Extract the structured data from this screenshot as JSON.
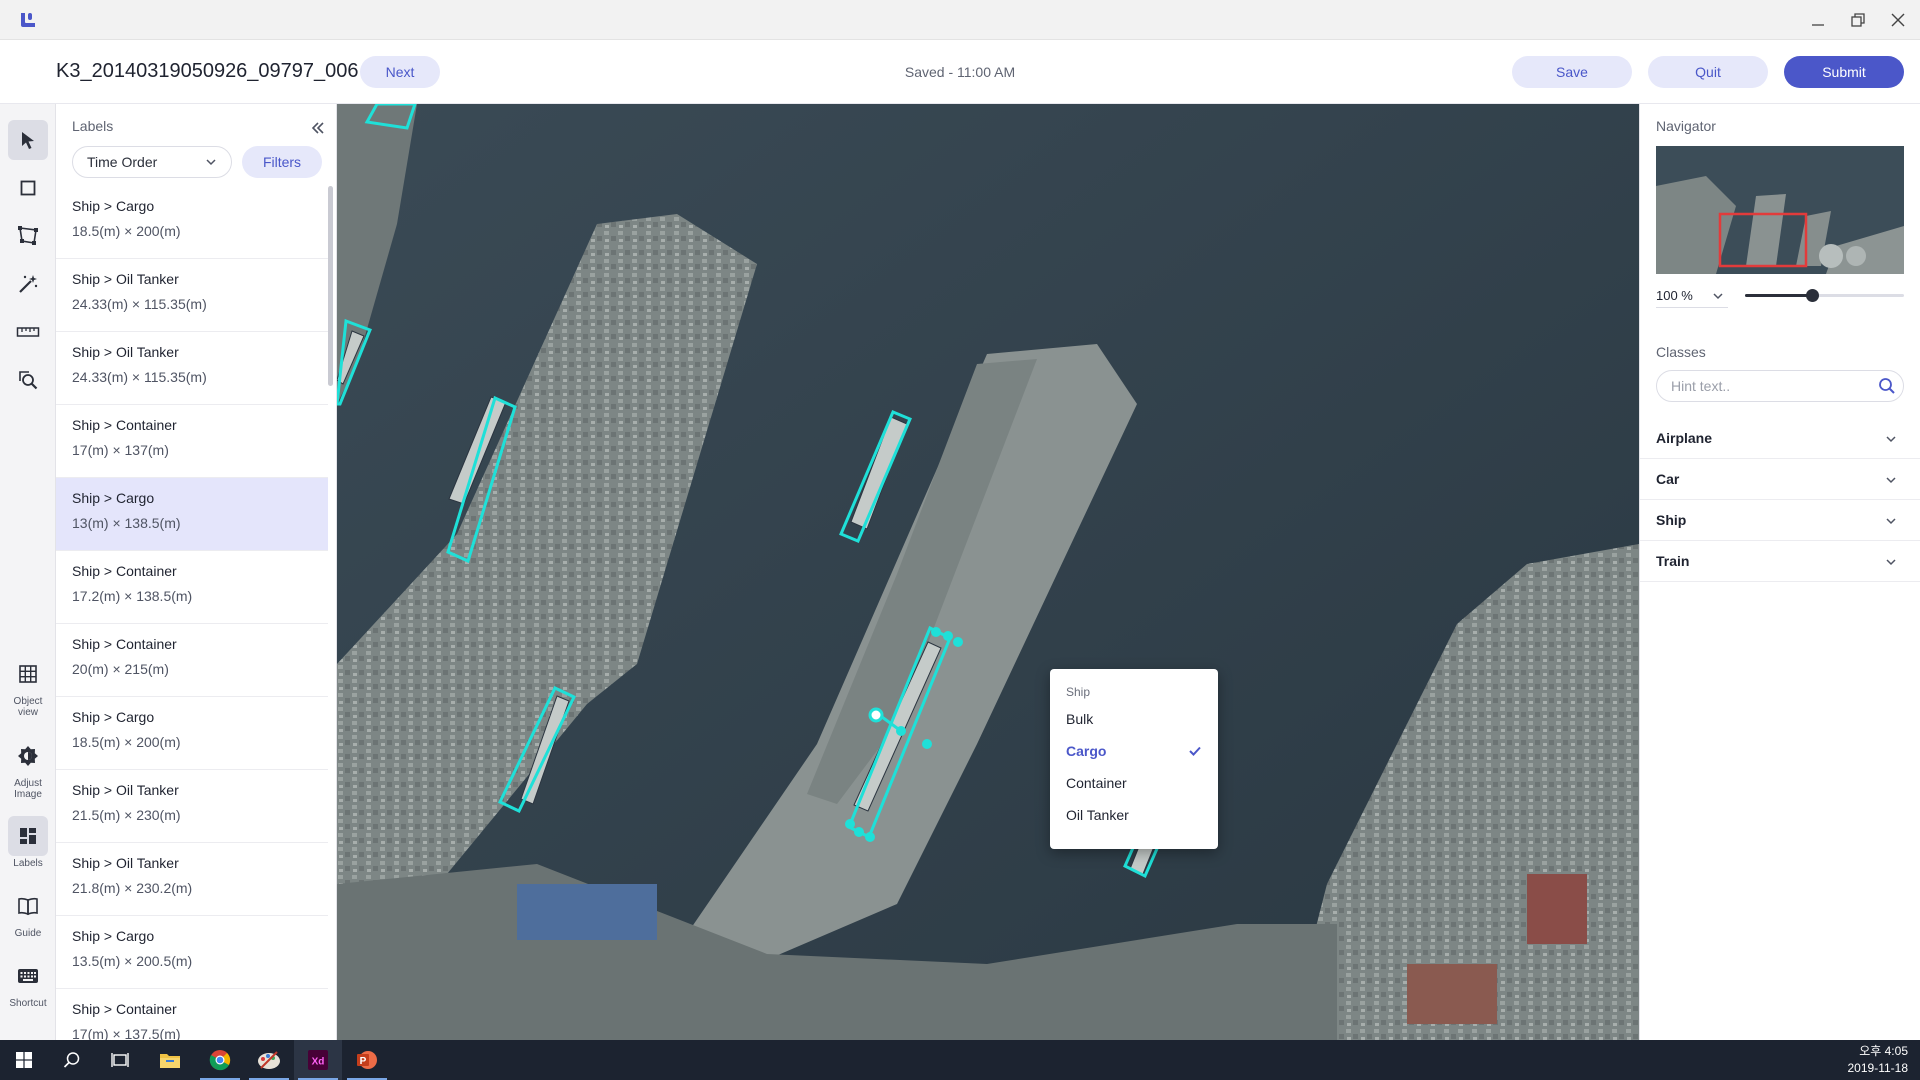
{
  "header": {
    "file_name": "K3_20140319050926_09797_006",
    "next_label": "Next",
    "saved_status": "Saved - 11:00 AM",
    "save_label": "Save",
    "quit_label": "Quit",
    "submit_label": "Submit"
  },
  "toolbar": {
    "tools": [
      "select-tool",
      "rectangle-tool",
      "polygon-tool",
      "magic-wand-tool",
      "measure-tool",
      "inspect-tool"
    ],
    "object_view_label": "Object view",
    "adjust_image_label": "Adjust Image",
    "labels_label": "Labels",
    "guide_label": "Guide",
    "shortcut_label": "Shortcut"
  },
  "labels_panel": {
    "title": "Labels",
    "sort_value": "Time Order",
    "filters_label": "Filters",
    "items": [
      {
        "class": "Ship > Cargo",
        "dims": "18.5(m) × 200(m)"
      },
      {
        "class": "Ship > Oil Tanker",
        "dims": "24.33(m) × 115.35(m)"
      },
      {
        "class": "Ship > Oil Tanker",
        "dims": "24.33(m) × 115.35(m)"
      },
      {
        "class": "Ship > Container",
        "dims": "17(m) × 137(m)"
      },
      {
        "class": "Ship > Cargo",
        "dims": "13(m) × 138.5(m)"
      },
      {
        "class": "Ship > Container",
        "dims": "17.2(m) × 138.5(m)"
      },
      {
        "class": "Ship > Container",
        "dims": "20(m) × 215(m)"
      },
      {
        "class": "Ship > Cargo",
        "dims": "18.5(m) × 200(m)"
      },
      {
        "class": "Ship > Oil Tanker",
        "dims": "21.5(m) × 230(m)"
      },
      {
        "class": "Ship > Oil Tanker",
        "dims": "21.8(m) × 230.2(m)"
      },
      {
        "class": "Ship > Cargo",
        "dims": "13.5(m) × 200.5(m)"
      },
      {
        "class": "Ship > Container",
        "dims": "17(m) × 137.5(m)"
      }
    ],
    "selected_index": 4
  },
  "dropdown": {
    "header": "Ship",
    "options": [
      "Bulk",
      "Cargo",
      "Container",
      "Oil Tanker"
    ],
    "selected": "Cargo"
  },
  "right_panel": {
    "navigator_title": "Navigator",
    "zoom_value": "100 %",
    "zoom_slider_fraction": 0.42,
    "classes_title": "Classes",
    "search_placeholder": "Hint text..",
    "classes": [
      "Airplane",
      "Car",
      "Ship",
      "Train"
    ]
  },
  "annotation_color": "#1fe0d8",
  "accent_color": "#4b57c9",
  "taskbar": {
    "apps": [
      "windows-start-icon",
      "search-icon",
      "task-view-icon",
      "file-explorer-icon",
      "chrome-icon",
      "paint-icon",
      "adobe-xd-icon",
      "powerpoint-icon"
    ],
    "clock_time": "오후 4:05",
    "clock_date": "2019-11-18"
  }
}
